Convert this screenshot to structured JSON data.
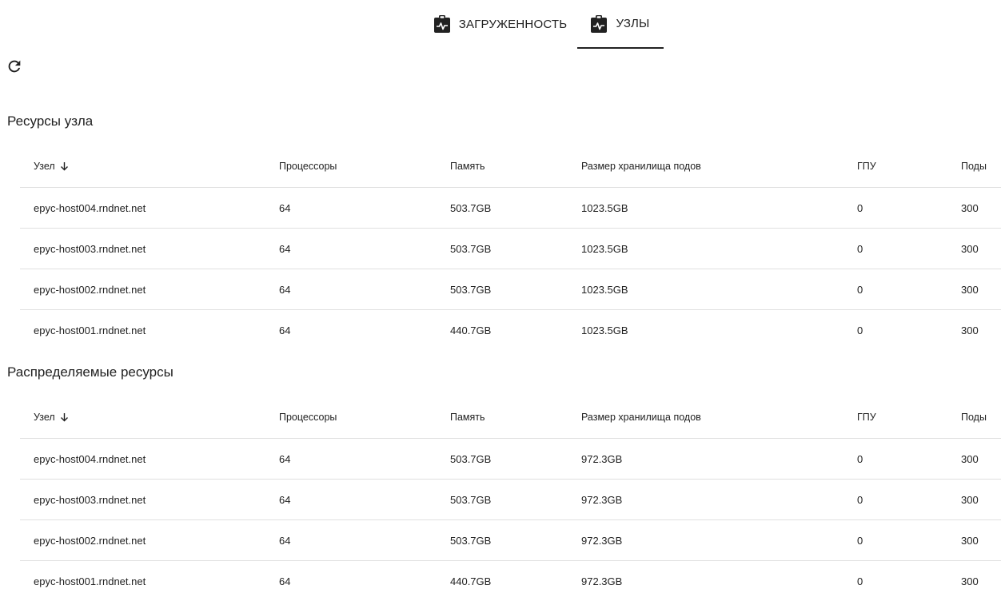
{
  "tabs": [
    {
      "label": "ЗАГРУЖЕННОСТЬ",
      "icon": "monitor-clipboard-icon",
      "active": false
    },
    {
      "label": "УЗЛЫ",
      "icon": "monitor-clipboard-icon",
      "active": true
    }
  ],
  "refresh_icon": "refresh-icon",
  "node_resources": {
    "title": "Ресурсы узла",
    "columns": [
      "Узел",
      "Процессоры",
      "Память",
      "Размер хранилища подов",
      "ГПУ",
      "Поды"
    ],
    "sort_icon": "arrow-down-icon",
    "rows": [
      [
        "epyc-host004.rndnet.net",
        "64",
        "503.7GB",
        "1023.5GB",
        "0",
        "300"
      ],
      [
        "epyc-host003.rndnet.net",
        "64",
        "503.7GB",
        "1023.5GB",
        "0",
        "300"
      ],
      [
        "epyc-host002.rndnet.net",
        "64",
        "503.7GB",
        "1023.5GB",
        "0",
        "300"
      ],
      [
        "epyc-host001.rndnet.net",
        "64",
        "440.7GB",
        "1023.5GB",
        "0",
        "300"
      ]
    ]
  },
  "allocatable_resources": {
    "title": "Распределяемые ресурсы",
    "columns": [
      "Узел",
      "Процессоры",
      "Память",
      "Размер хранилища подов",
      "ГПУ",
      "Поды"
    ],
    "sort_icon": "arrow-down-icon",
    "rows": [
      [
        "epyc-host004.rndnet.net",
        "64",
        "503.7GB",
        "972.3GB",
        "0",
        "300"
      ],
      [
        "epyc-host003.rndnet.net",
        "64",
        "503.7GB",
        "972.3GB",
        "0",
        "300"
      ],
      [
        "epyc-host002.rndnet.net",
        "64",
        "503.7GB",
        "972.3GB",
        "0",
        "300"
      ],
      [
        "epyc-host001.rndnet.net",
        "64",
        "440.7GB",
        "972.3GB",
        "0",
        "300"
      ]
    ]
  }
}
